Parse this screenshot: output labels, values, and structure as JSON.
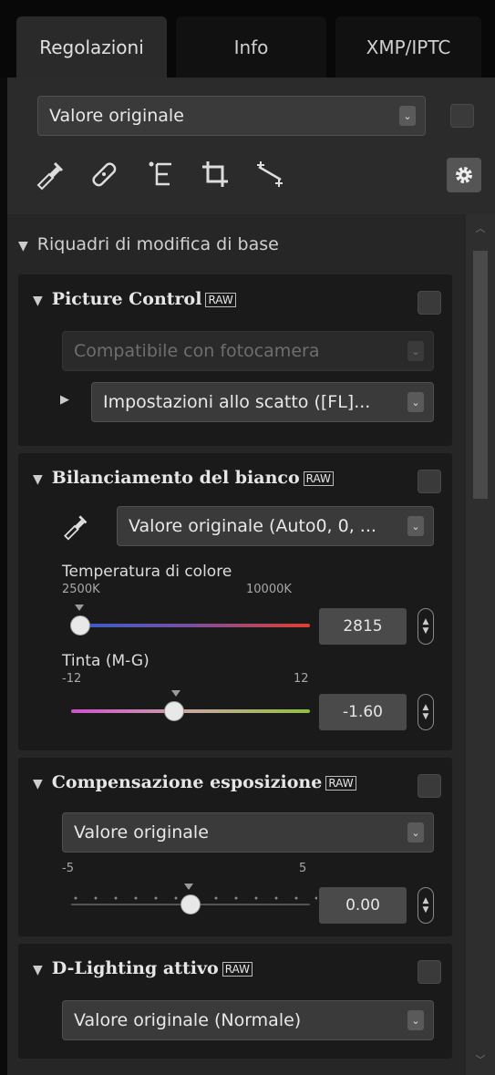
{
  "tabs": [
    {
      "label": "Regolazioni",
      "active": true
    },
    {
      "label": "Info",
      "active": false
    },
    {
      "label": "XMP/IPTC",
      "active": false
    }
  ],
  "toolbar": {
    "preset_select": "Valore originale",
    "tools": [
      "eyedropper-icon",
      "retouch-icon",
      "lcc-icon",
      "crop-icon",
      "straighten-icon"
    ],
    "settings_icon": "gear-icon"
  },
  "section": {
    "title": "Riquadri di modifica di base"
  },
  "picture_control": {
    "title": "Picture Control",
    "raw_badge": "RAW",
    "compat_select": "Compatibile con fotocamera",
    "shooting_select": "Impostazioni allo scatto ([FL]..."
  },
  "white_balance": {
    "title": "Bilanciamento del bianco",
    "raw_badge": "RAW",
    "select": "Valore originale (Auto0, 0, ...",
    "temperature": {
      "label": "Temperatura di colore",
      "min": "2500K",
      "max": "10000K",
      "value": "2815",
      "slider_fraction": 0.04
    },
    "tint": {
      "label": "Tinta (M-G)",
      "min": "-12",
      "max": "12",
      "value": "-1.60",
      "slider_fraction": 0.43
    }
  },
  "exposure": {
    "title": "Compensazione esposizione",
    "raw_badge": "RAW",
    "select": "Valore originale",
    "min": "-5",
    "max": "5",
    "value": "0.00",
    "slider_fraction": 0.5
  },
  "d_lighting": {
    "title": "D-Lighting attivo",
    "raw_badge": "RAW",
    "select": "Valore originale (Normale)"
  },
  "colors": {
    "panel": "#262626",
    "card": "#1a1a1a",
    "accent": "#e8e8e8"
  }
}
